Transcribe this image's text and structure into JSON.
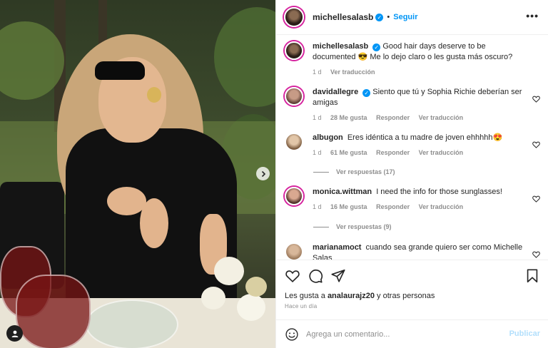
{
  "post": {
    "username": "michellesalasb",
    "follow_label": "Seguir",
    "dot": "•",
    "more_label": "•••"
  },
  "caption": {
    "username": "michellesalasb",
    "text": "Good hair days deserve to be documented 😎 Me lo dejo claro o les gusta más oscuro?",
    "age": "1 d",
    "translate": "Ver traducción"
  },
  "comments": [
    {
      "username": "davidallegre",
      "verified": true,
      "text": "Siento que tú y Sophia Richie deberían ser amigas",
      "age": "1 d",
      "likes": "28 Me gusta",
      "reply": "Responder",
      "translate": "Ver traducción"
    },
    {
      "username": "albugon",
      "verified": false,
      "text": "Eres idéntica a tu madre de joven ehhhhh😍",
      "age": "1 d",
      "likes": "61 Me gusta",
      "reply": "Responder",
      "translate": "Ver traducción",
      "replies": "Ver respuestas (17)"
    },
    {
      "username": "monica.wittman",
      "verified": false,
      "text": "I need the info for those sunglasses!",
      "age": "1 d",
      "likes": "16 Me gusta",
      "reply": "Responder",
      "translate": "Ver traducción",
      "replies": "Ver respuestas (9)"
    },
    {
      "username": "marianamoct",
      "verified": false,
      "text": "cuando sea grande quiero ser como Michelle Salas"
    }
  ],
  "footer": {
    "likes_prefix": "Les gusta a",
    "likes_user": "analaurajz20",
    "likes_suffix": "y otras personas",
    "time": "Hace un día",
    "comment_placeholder": "Agrega un comentario...",
    "publish_label": "Publicar"
  },
  "colors": {
    "accent": "#0095f6",
    "publish_disabled": "#b2dffc",
    "muted": "#8e8e8e",
    "story_ring": "#d6249f"
  },
  "icons": [
    "chevron-right-icon",
    "user-tag-icon",
    "verified-badge-icon",
    "more-options-icon",
    "heart-icon",
    "comment-icon",
    "share-icon",
    "bookmark-icon",
    "emoji-icon"
  ]
}
